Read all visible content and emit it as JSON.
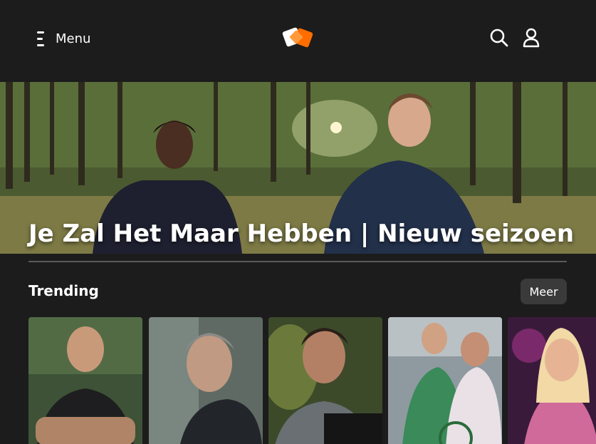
{
  "header": {
    "menu_label": "Menu",
    "logo_name": "npo-start-logo",
    "search_icon": "search-icon",
    "account_icon": "user-icon"
  },
  "hero": {
    "title": "Je Zal Het Maar Hebben | Nieuw seizoen"
  },
  "trending": {
    "title": "Trending",
    "more_label": "Meer",
    "cards": [
      {
        "name": "trending-card-1"
      },
      {
        "name": "trending-card-2"
      },
      {
        "name": "trending-card-3"
      },
      {
        "name": "trending-card-4"
      },
      {
        "name": "trending-card-5"
      }
    ]
  },
  "colors": {
    "background": "#1c1c1c",
    "brand_orange": "#ff6d00",
    "button_bg": "#3a3a3a"
  }
}
